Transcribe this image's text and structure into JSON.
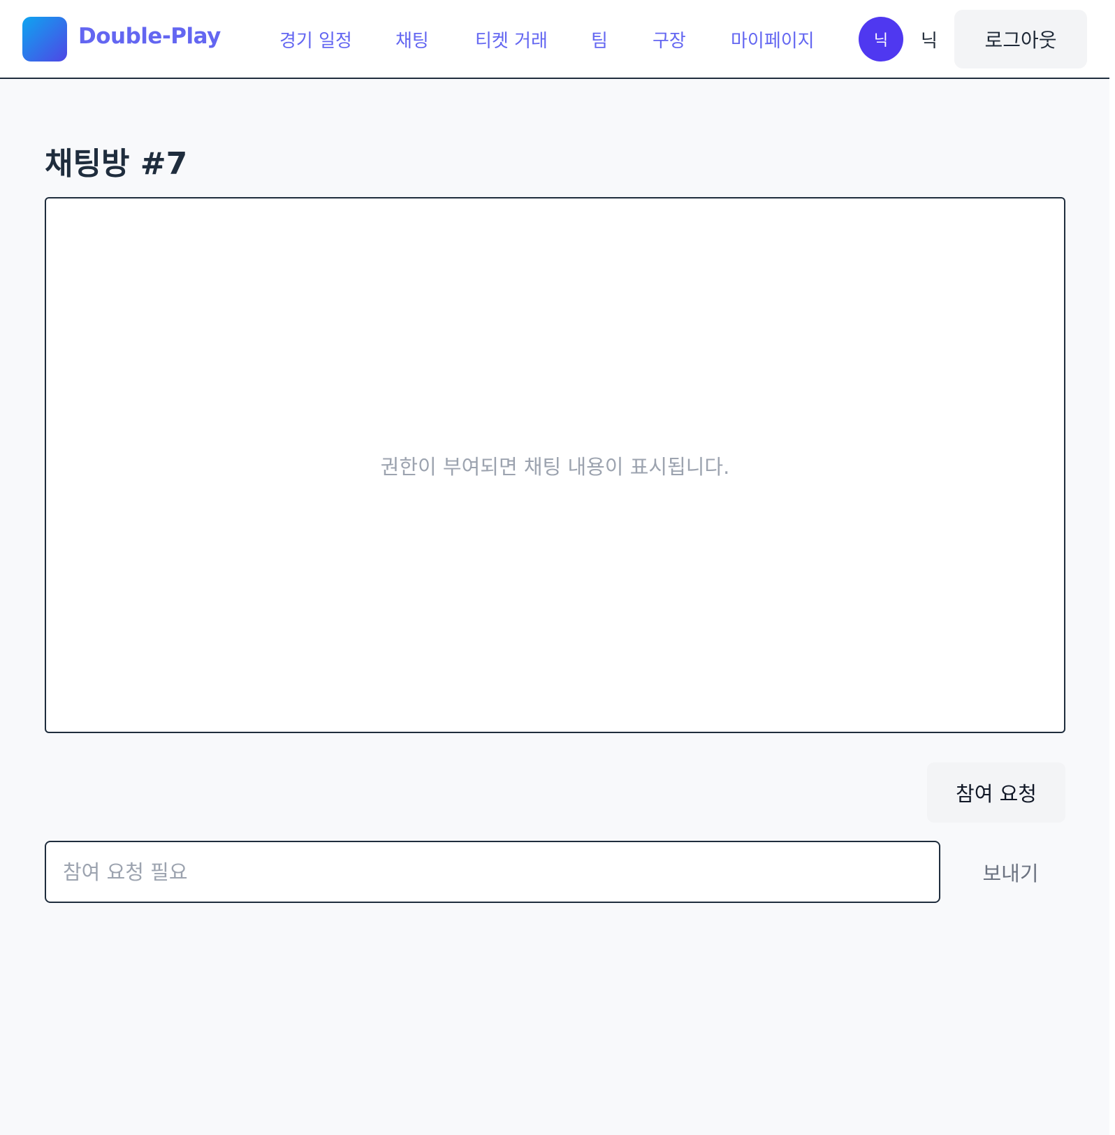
{
  "header": {
    "brand": "Double-Play",
    "nav": [
      {
        "label": "경기 일정"
      },
      {
        "label": "채팅"
      },
      {
        "label": "티켓 거래"
      },
      {
        "label": "팀"
      },
      {
        "label": "구장"
      },
      {
        "label": "마이페이지"
      }
    ],
    "user": {
      "avatar_initial": "닉",
      "name": "닉"
    },
    "logout_label": "로그아웃"
  },
  "main": {
    "title": "채팅방 #7",
    "empty_message": "권한이 부여되면 채팅 내용이 표시됩니다.",
    "join_label": "참여 요청",
    "input_placeholder": "참여 요청 필요",
    "send_label": "보내기"
  },
  "colors": {
    "accent": "#6366f1",
    "avatar_bg": "#4f38f0",
    "text_dark": "#1f2d3d",
    "muted": "#9ca3af",
    "page_bg": "#f8f9fb"
  },
  "icons": {
    "logo": "gradient-square-logo"
  }
}
